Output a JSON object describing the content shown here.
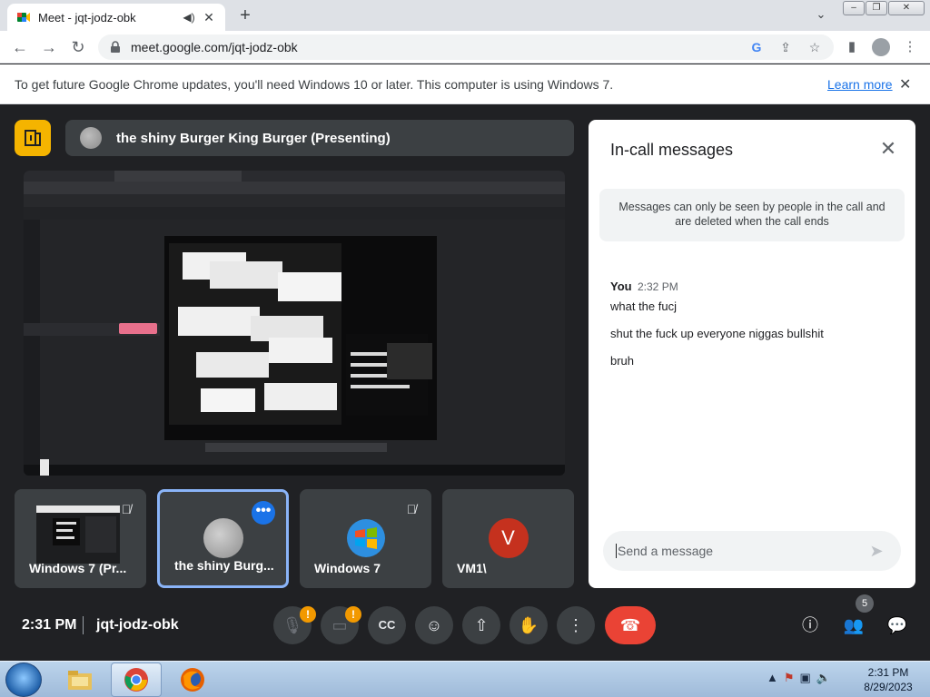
{
  "browser": {
    "tab_title": "Meet - jqt-jodz-obk",
    "url": "meet.google.com/jqt-jodz-obk",
    "infobar_message": "To get future Google Chrome updates, you'll need Windows 10 or later. This computer is using Windows 7.",
    "infobar_link": "Learn more"
  },
  "meet": {
    "presenter_label": "the shiny Burger King Burger (Presenting)",
    "tiles": [
      {
        "label": "Windows 7 (Pr..."
      },
      {
        "label": "the shiny Burg..."
      },
      {
        "label": "Windows 7"
      },
      {
        "label": "VM1\\",
        "initial": "V"
      }
    ],
    "time": "2:31 PM",
    "meeting_code": "jqt-jodz-obk",
    "people_count": "5"
  },
  "chat": {
    "title": "In-call messages",
    "notice": "Messages can only be seen by people in the call and are deleted when the call ends",
    "sender": "You",
    "time": "2:32 PM",
    "messages": [
      "what the fucj",
      "shut the fuck up everyone niggas bullshit",
      "bruh"
    ],
    "input_placeholder": "Send a message"
  },
  "taskbar": {
    "time": "2:31 PM",
    "date": "8/29/2023"
  },
  "colors": {
    "meet_bg": "#202124",
    "accent_blue": "#1a73e8",
    "hangup_red": "#ea4335",
    "logo_yellow": "#f5b400",
    "warning_orange": "#f29900"
  }
}
